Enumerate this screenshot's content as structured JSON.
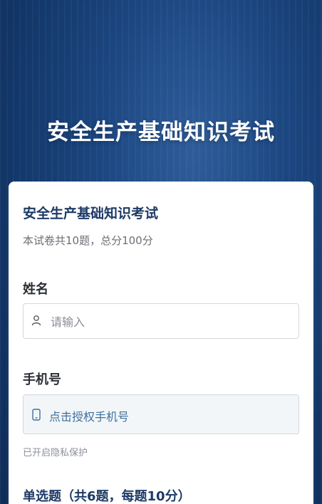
{
  "header": {
    "title": "安全生产基础知识考试"
  },
  "exam": {
    "title": "安全生产基础知识考试",
    "subtitle": "本试卷共10题，总分100分"
  },
  "form": {
    "name": {
      "label": "姓名",
      "placeholder": "请输入",
      "value": "",
      "icon": "user-icon"
    },
    "phone": {
      "label": "手机号",
      "button_text": "点击授权手机号",
      "icon": "phone-icon",
      "privacy_note": "已开启隐私保护"
    }
  },
  "section": {
    "title": "单选题（共6题，每题10分）"
  },
  "colors": {
    "primary": "#1d3a66",
    "link": "#3d6f9e",
    "background": "#163c6e"
  }
}
